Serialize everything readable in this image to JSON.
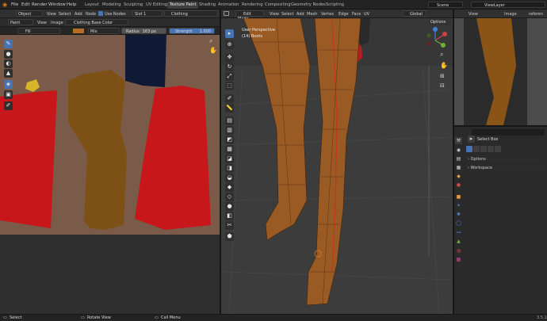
{
  "menubar": {
    "items": [
      "File",
      "Edit",
      "Render",
      "Window",
      "Help"
    ],
    "workspaces": [
      "Layout",
      "Modeling",
      "Sculpting",
      "UV Editing",
      "Texture Paint",
      "Shading",
      "Animation",
      "Rendering",
      "Compositing",
      "Geometry Nodes",
      "Scripting"
    ],
    "active_workspace": "Texture Paint",
    "scene": "Scene",
    "view_layer": "ViewLayer"
  },
  "image_editor": {
    "header": {
      "mode": "Paint",
      "menus": [
        "View",
        "Image"
      ],
      "image_name": "Clothing Base Color",
      "slot": "Slot 1",
      "material": "Clothing"
    },
    "tool_header": {
      "brush": "Fill",
      "blend": "Mix",
      "radius_label": "Radius",
      "radius_value": "163 px",
      "strength_label": "Strength",
      "strength_value": "1.000"
    },
    "object_mode": "Object",
    "menus_top": [
      "View",
      "Select",
      "Add",
      "Node"
    ],
    "use_nodes": "Use Nodes"
  },
  "viewport": {
    "mode": "Edit Mode",
    "menus": [
      "View",
      "Select",
      "Add",
      "Mesh",
      "Vertex",
      "Edge",
      "Face",
      "UV"
    ],
    "transform": "Global",
    "options": "Options",
    "overlay_title": "User Perspective",
    "overlay_subtitle": "(14) Boots"
  },
  "right_top": {
    "menus": [
      "View",
      "Image"
    ],
    "name": "referen"
  },
  "properties": {
    "active_tool": "Select Box",
    "panels": [
      "Options",
      "Workspace"
    ]
  },
  "statusbar": {
    "items": [
      "Select",
      "Rotate View",
      "Call Menu"
    ],
    "version": "3.5.1"
  },
  "colors": {
    "accent": "#4772b3",
    "background": "#1d1d1d",
    "header": "#303030",
    "texture_bg": "#7a5a49",
    "red": "#c8171a",
    "brown": "#7d5116",
    "navy": "#101a34",
    "yellow": "#d8b62a",
    "mesh": "#9a5a24",
    "viewport_bg": "#3c3c3c",
    "grid_line": "#454545"
  },
  "icons": [
    "blender-logo-icon",
    "draw-brush-icon",
    "soften-brush-icon",
    "smear-brush-icon",
    "clone-brush-icon",
    "fill-brush-icon",
    "mask-brush-icon",
    "annotate-icon",
    "select-box-icon",
    "cursor-icon",
    "move-icon",
    "rotate-icon",
    "scale-icon",
    "transform-icon",
    "annotate-icon",
    "measure-icon",
    "extrude-icon",
    "inset-icon",
    "bevel-icon",
    "loop-cut-icon",
    "knife-icon",
    "poly-build-icon",
    "spin-icon",
    "smooth-icon",
    "edge-slide-icon",
    "shrink-icon",
    "shear-icon",
    "rip-icon",
    "zoom-icon",
    "hand-icon",
    "camera-icon",
    "grid-icon",
    "navigation-gizmo-icon",
    "tool-icon",
    "render-icon",
    "output-icon",
    "view-layer-icon",
    "scene-icon",
    "world-icon",
    "object-icon",
    "modifier-icon",
    "particles-icon",
    "physics-icon",
    "constraints-icon",
    "data-icon",
    "material-icon",
    "texture-icon"
  ]
}
